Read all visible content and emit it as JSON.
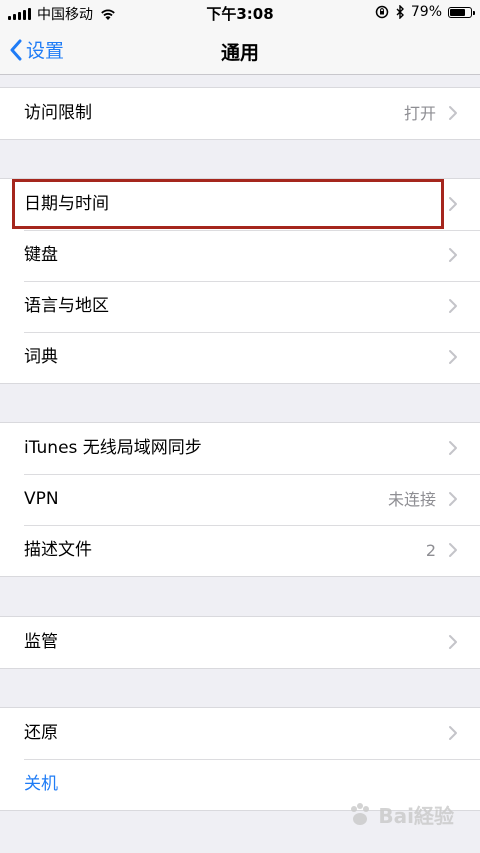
{
  "status_bar": {
    "carrier": "中国移动",
    "time": "下午3:08",
    "battery_percent": "79%",
    "battery_level": 0.79,
    "icons": [
      "signal-icon",
      "wifi-icon",
      "orientation-lock-icon",
      "bluetooth-icon",
      "battery-icon"
    ]
  },
  "nav": {
    "back_label": "设置",
    "title": "通用"
  },
  "groups": [
    {
      "items": [
        {
          "label": "访问限制",
          "value": "打开"
        }
      ]
    },
    {
      "items": [
        {
          "label": "日期与时间"
        },
        {
          "label": "键盘"
        },
        {
          "label": "语言与地区"
        },
        {
          "label": "词典"
        }
      ]
    },
    {
      "items": [
        {
          "label": "iTunes 无线局域网同步"
        },
        {
          "label": "VPN",
          "value": "未连接"
        },
        {
          "label": "描述文件",
          "value": "2"
        }
      ]
    },
    {
      "items": [
        {
          "label": "监管"
        }
      ]
    },
    {
      "items": [
        {
          "label": "还原"
        },
        {
          "label": "关机"
        }
      ]
    }
  ],
  "watermark": {
    "text": "Bai経验"
  },
  "colors": {
    "accent": "#1f7cf6",
    "highlight": "#a5261d",
    "background": "#efeff4"
  }
}
